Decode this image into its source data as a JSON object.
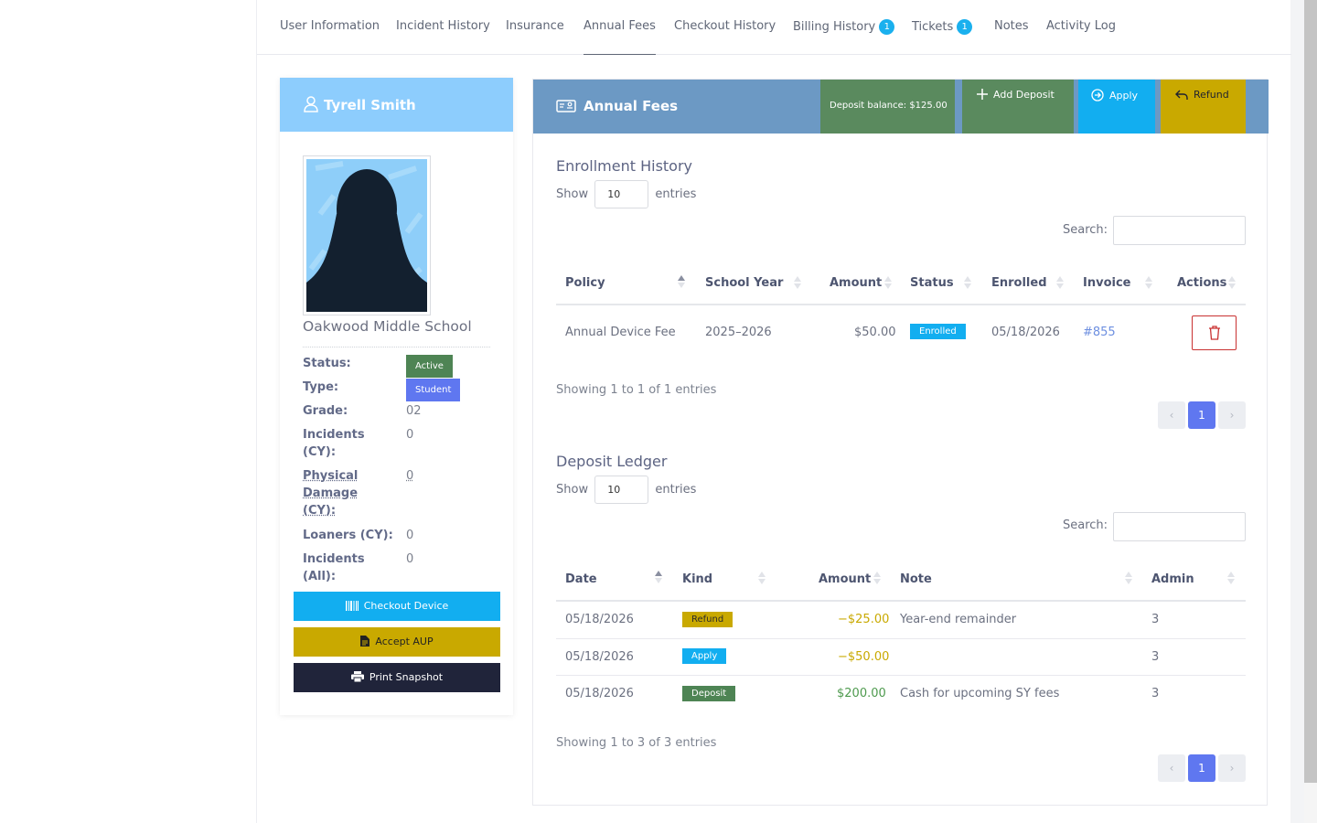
{
  "tabs": [
    {
      "label": "User Information"
    },
    {
      "label": "Incident History"
    },
    {
      "label": "Insurance"
    },
    {
      "label": "Annual Fees",
      "active": true
    },
    {
      "label": "Checkout History"
    },
    {
      "label": "Billing History",
      "badge": "1"
    },
    {
      "label": "Tickets",
      "badge": "1"
    },
    {
      "label": "Notes"
    },
    {
      "label": "Activity Log"
    }
  ],
  "profile": {
    "name": "Tyrell Smith",
    "school": "Oakwood Middle School",
    "fields": [
      {
        "label": "Status:",
        "value": "Active",
        "kind": "pill",
        "color": "#4e8454"
      },
      {
        "label": "Type:",
        "value": "Student",
        "kind": "pill",
        "color": "#5f77f0"
      },
      {
        "label": "Grade:",
        "value": "02"
      },
      {
        "label_lines": [
          "Incidents",
          "(CY):"
        ],
        "value": "0"
      },
      {
        "label_lines": [
          "Physical",
          "Damage",
          "(CY):"
        ],
        "value": "0",
        "abbr": true
      },
      {
        "label": "Loaners (CY):",
        "value": "0"
      },
      {
        "label_lines": [
          "Incidents",
          "(All):"
        ],
        "value": "0"
      }
    ],
    "buttons": {
      "checkout": "Checkout Device",
      "accept": "Accept AUP",
      "print": "Print Snapshot"
    }
  },
  "fees": {
    "title": "Annual Fees",
    "deposit_balance": "Deposit balance: $125.00",
    "add_deposit": "Add Deposit",
    "apply": "Apply",
    "refund": "Refund"
  },
  "enrollment": {
    "title": "Enrollment History",
    "show_label": "Show",
    "entries_label": "entries",
    "page_size": "10",
    "search_label": "Search:",
    "columns": [
      "Policy",
      "School Year",
      "Amount",
      "Status",
      "Enrolled",
      "Invoice",
      "Actions"
    ],
    "rows": [
      {
        "policy": "Annual Device Fee",
        "school_year": "2025–2026",
        "amount": "$50.00",
        "status": "Enrolled",
        "enrolled": "05/18/2026",
        "invoice": "#855"
      }
    ],
    "info": "Showing 1 to 1 of 1 entries",
    "page": "1"
  },
  "ledger": {
    "title": "Deposit Ledger",
    "show_label": "Show",
    "entries_label": "entries",
    "page_size": "10",
    "search_label": "Search:",
    "columns": [
      "Date",
      "Kind",
      "Amount",
      "Note",
      "Admin"
    ],
    "rows": [
      {
        "date": "05/18/2026",
        "kind": "Refund",
        "kind_color": "#c9a900",
        "amount": "−$25.00",
        "amount_color": "#c9a900",
        "note": "Year-end remainder",
        "admin": "3"
      },
      {
        "date": "05/18/2026",
        "kind": "Apply",
        "kind_color": "#1ab0ee",
        "amount": "−$50.00",
        "amount_color": "#c9a900",
        "note": "",
        "admin": "3"
      },
      {
        "date": "05/18/2026",
        "kind": "Deposit",
        "kind_color": "#4e8454",
        "amount": "$200.00",
        "amount_color": "#4e9a4e",
        "note": "Cash for upcoming SY fees",
        "admin": "3"
      }
    ],
    "info": "Showing 1 to 3 of 3 entries",
    "page": "1"
  },
  "colors": {
    "profile_header": "#8dcdfd",
    "fees_header": "#6c99c4",
    "deposit_green": "#5a8a5e",
    "add_deposit_green": "#5a8a5e",
    "apply_blue": "#12aef0",
    "refund_yellow": "#c9a900",
    "accent_blue": "#5f77f0"
  }
}
